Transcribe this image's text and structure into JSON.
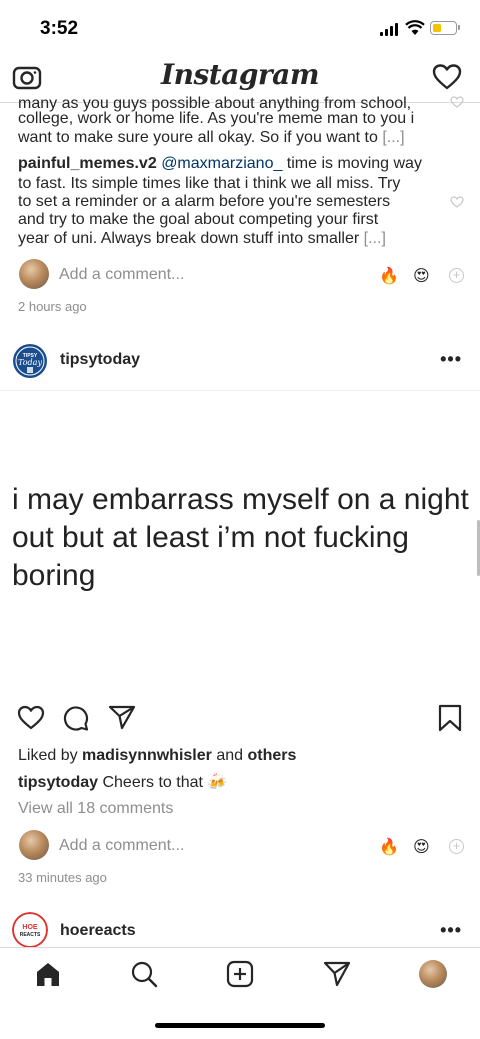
{
  "status_bar": {
    "time": "3:52",
    "icons": [
      "signal-icon",
      "wifi-icon",
      "battery-icon"
    ],
    "battery_color": "#f5c400"
  },
  "header": {
    "title": "Instagram",
    "left_icon": "camera-icon",
    "right_icon": "heart-icon"
  },
  "prev_post": {
    "cut_text": "many as you guys possible about anything from school,",
    "caption_line2": "college, work or home life. As you're meme man to you i",
    "caption_line3_text": "want to make sure youre all okay. So if you want to ",
    "caption_more": "[...]",
    "comment": {
      "username": "painful_memes.v2",
      "mention": "@maxmarziano_",
      "line1_rest": " time is moving way",
      "line2": "to fast. Its simple times like that i think we all miss. Try",
      "line3": "to set a reminder or a alarm before you're semesters",
      "line4": "and try to make the goal about competing your first",
      "line5_text": "year of uni. Always break down stuff into smaller ",
      "more": "[...]"
    },
    "add_comment_placeholder": "Add a comment...",
    "reactions": [
      "🔥",
      "😍"
    ],
    "timestamp": "2 hours ago"
  },
  "post": {
    "username": "tipsytoday",
    "avatar_text": "Tipsy Today",
    "more_label": "•••",
    "image_text": "i may embarrass myself on a night out but at least i’m not fucking boring",
    "liked_prefix": "Liked by ",
    "liked_user": "madisynnwhisler",
    "liked_and": " and ",
    "liked_others": "others",
    "caption_user": "tipsytoday",
    "caption_text": " Cheers to that 🍻",
    "view_comments": "View all 18 comments",
    "add_comment_placeholder": "Add a comment...",
    "reactions": [
      "🔥",
      "😍"
    ],
    "timestamp": "33 minutes ago",
    "accent": "#1a4d8f"
  },
  "next_post": {
    "username": "hoereacts",
    "avatar_text": "HOE REACTS",
    "more_label": "•••",
    "accent": "#e0312d"
  },
  "tab_bar": {
    "items": [
      "home-icon",
      "search-icon",
      "new-post-icon",
      "activity-icon",
      "profile-avatar"
    ]
  }
}
